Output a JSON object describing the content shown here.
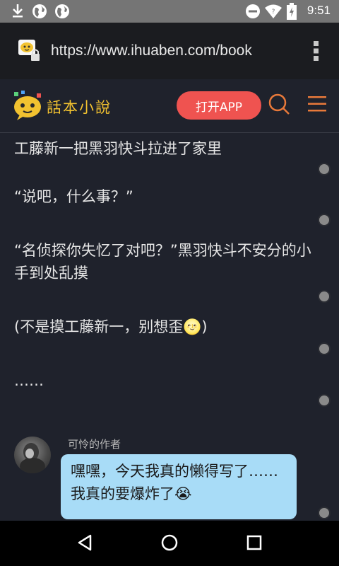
{
  "status_bar": {
    "time": "9:51",
    "icons": [
      "download-icon",
      "globe-icon",
      "globe-icon",
      "do-not-disturb-icon",
      "wifi-icon",
      "battery-icon"
    ]
  },
  "browser": {
    "url": "https://www.ihuaben.com/book",
    "menu_icon": "more-vertical-icon"
  },
  "header": {
    "logo_text": "話本小說",
    "open_app_label": "打开APP",
    "accent_color": "#ef5350",
    "icon_color": "#e8793a"
  },
  "story": {
    "paragraphs": [
      "工藤新一把黑羽快斗拉进了家里",
      "“说吧，什么事？”",
      "“名侦探你失忆了对吧？”黑羽快斗不安分的小手到处乱摸",
      "(不是摸工藤新一，别想歪",
      "……"
    ],
    "emoji_after_para4": "🌝",
    "para4_close": ")"
  },
  "comment": {
    "author": "可怜的作者",
    "text": "嘿嘿，今天我真的懒得写了……我真的要爆炸了",
    "emoji": "😭",
    "bubble_color": "#a8dcf7"
  },
  "nav": {
    "back": "back-icon",
    "home": "home-icon",
    "recents": "recents-icon"
  }
}
